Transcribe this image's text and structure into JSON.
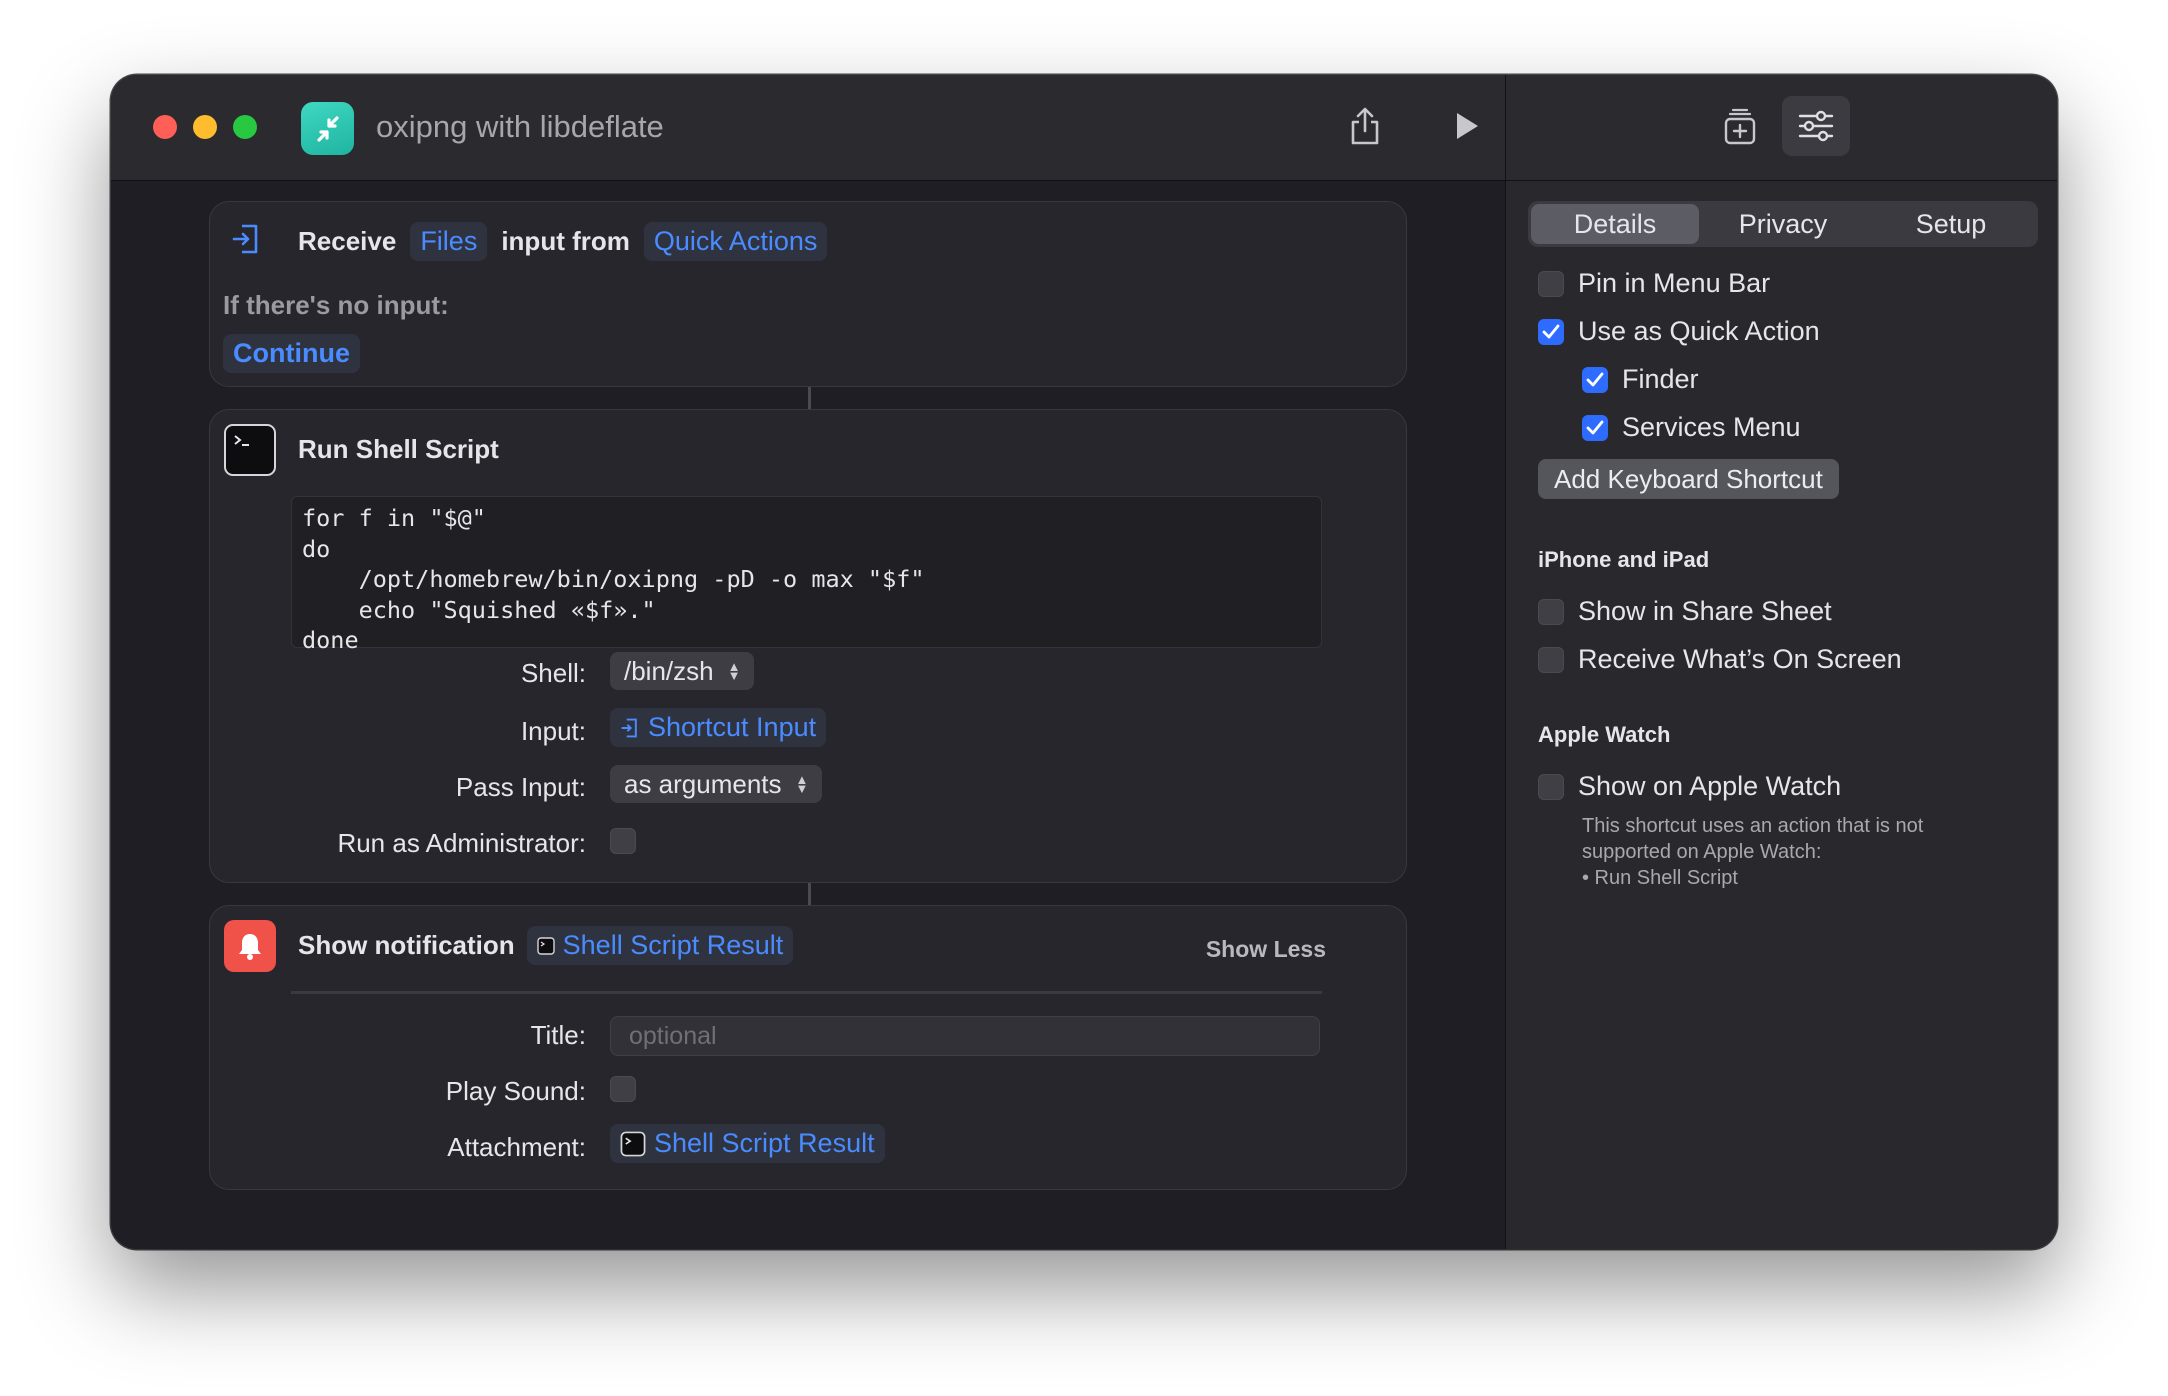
{
  "window": {
    "title": "oxipng with libdeflate"
  },
  "toolbar": {
    "share_icon": "share-icon",
    "run_icon": "play-icon",
    "library_icon": "add-library-icon",
    "settings_icon": "sliders-icon"
  },
  "receive": {
    "label": "Receive",
    "type_token": "Files",
    "from_label": "input from",
    "source_token": "Quick Actions",
    "no_input_label": "If there's no input:",
    "no_input_token": "Continue"
  },
  "shell": {
    "title": "Run Shell Script",
    "script": "for f in \"$@\"\ndo\n    /opt/homebrew/bin/oxipng -pD -o max \"$f\"\n    echo \"Squished «$f».\"\ndone",
    "shell_label": "Shell:",
    "shell_value": "/bin/zsh",
    "input_label": "Input:",
    "input_value": "Shortcut Input",
    "pass_label": "Pass Input:",
    "pass_value": "as arguments",
    "admin_label": "Run as Administrator:"
  },
  "notify": {
    "title": "Show notification",
    "result_token": "Shell Script Result",
    "show_less": "Show Less",
    "title_label": "Title:",
    "title_placeholder": "optional",
    "sound_label": "Play Sound:",
    "attachment_label": "Attachment:",
    "attachment_token": "Shell Script Result"
  },
  "inspector": {
    "tabs": [
      "Details",
      "Privacy",
      "Setup"
    ],
    "active_tab": "Details",
    "pin_menu_bar": "Pin in Menu Bar",
    "quick_action": "Use as Quick Action",
    "finder": "Finder",
    "services_menu": "Services Menu",
    "add_shortcut": "Add Keyboard Shortcut",
    "iphone_head": "iPhone and iPad",
    "share_sheet": "Show in Share Sheet",
    "on_screen": "Receive What’s On Screen",
    "watch_head": "Apple Watch",
    "show_watch": "Show on Apple Watch",
    "watch_note": "This shortcut uses an action that is not supported on Apple Watch:",
    "watch_note_item": "• Run Shell Script"
  },
  "colors": {
    "accent": "#2e6bff",
    "token_text": "#4a8cff",
    "app_icon": "#2fc8b2",
    "notify_icon": "#f0524a"
  }
}
